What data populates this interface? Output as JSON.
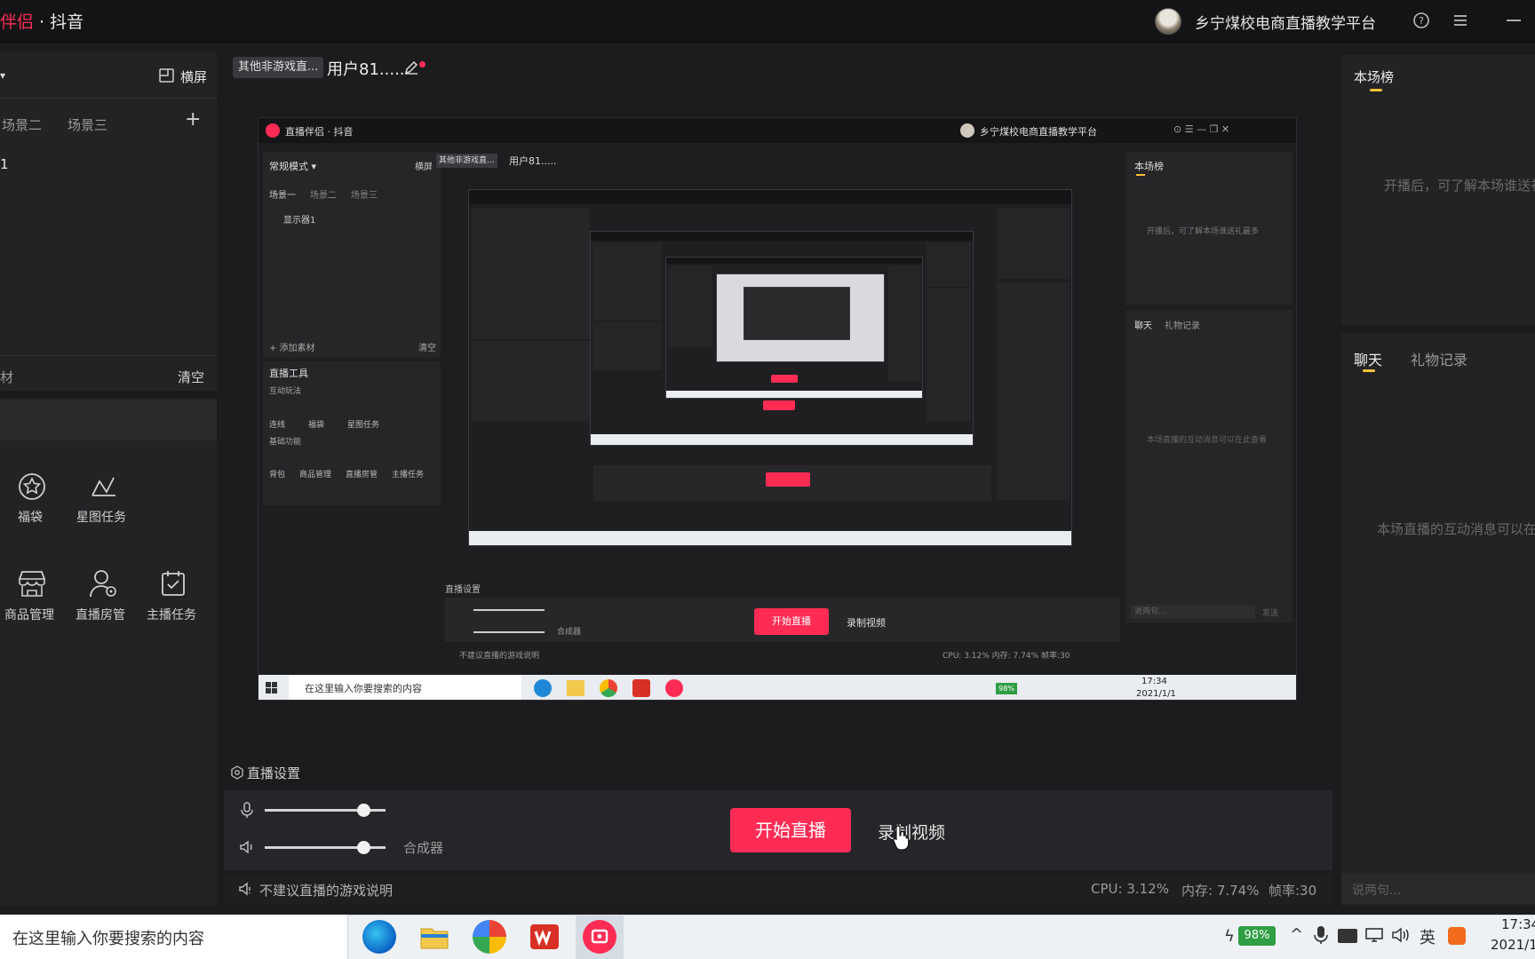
{
  "app": {
    "title_brand": "伴侣",
    "title_sep": " · ",
    "title_platform": "抖音"
  },
  "account": {
    "name": "乡宁煤校电商直播教学平台"
  },
  "icons": {
    "help": "help-circle-icon",
    "menu": "menu-icon",
    "minimize": "minimize-icon"
  },
  "left": {
    "mode_dropdown": "▾",
    "landscape": "横屏",
    "scenes": [
      "场景二",
      "场景三"
    ],
    "add_scene": "+",
    "source_item": "1",
    "material": "材",
    "clear": "清空",
    "tools": [
      {
        "label": "福袋",
        "icon": "lucky-bag-icon"
      },
      {
        "label": "星图任务",
        "icon": "star-map-icon"
      },
      {
        "label": "商品管理",
        "icon": "store-icon"
      },
      {
        "label": "直播房管",
        "icon": "room-admin-icon"
      },
      {
        "label": "主播任务",
        "icon": "task-check-icon"
      }
    ]
  },
  "center": {
    "category": "其他非游戏直...",
    "user": "用户81.....",
    "settings_label": "直播设置",
    "start_live": "开始直播",
    "record_video": "录制视频",
    "synth": "合成器",
    "mic_level": 0.82,
    "speaker_level": 0.82,
    "notice": "不建议直播的游戏说明",
    "cpu": "CPU: 3.12%",
    "memory": "内存: 7.74%",
    "fps": "帧率:30"
  },
  "preview": {
    "title": "直播伴侣 · 抖音",
    "account": "乡宁煤校电商直播教学平台",
    "mode": "常规模式 ▾",
    "landscape": "横屏",
    "scenes": [
      "场景一",
      "场景二",
      "场景三"
    ],
    "display": "显示器1",
    "add_material": "+ 添加素材",
    "clear": "清空",
    "tools_title": "直播工具",
    "interact": "互动玩法",
    "tools_a": [
      "连线",
      "福袋",
      "星图任务"
    ],
    "basic": "基础功能",
    "tools_b": [
      "背包",
      "商品管理",
      "直播房管",
      "主播任务"
    ],
    "category": "其他非游戏直...",
    "user": "用户81.....",
    "rank": "本场榜",
    "rank_hint": "开播后，可了解本场谁送礼最多",
    "chat": "聊天",
    "gifts": "礼物记录",
    "chat_hint": "本场直播的互动消息可以在此查看",
    "say": "说两句...",
    "send": "发送",
    "settings": "直播设置",
    "start": "开始直播",
    "record": "录制视频",
    "synth": "合成器",
    "notice": "不建议直播的游戏说明",
    "stats": "CPU: 3.12%   内存: 7.74%   帧率:30",
    "search": "在这里输入你要搜索的内容",
    "battery": "98%",
    "time": "17:34",
    "date": "2021/1/1"
  },
  "right": {
    "rank_tab": "本场榜",
    "rank_hint": "开播后，可了解本场谁送礼",
    "chat_tab": "聊天",
    "gift_tab": "礼物记录",
    "chat_hint": "本场直播的互动消息可以在",
    "input_placeholder": "说两句..."
  },
  "taskbar": {
    "search": "在这里输入你要搜索的内容",
    "battery": "98%",
    "ime": "英",
    "time": "17:34",
    "date": "2021/1"
  },
  "colors": {
    "accent": "#fe2c55",
    "tab_underline": "#f6c23a",
    "bg": "#1c1c1f",
    "panel": "#232326"
  }
}
